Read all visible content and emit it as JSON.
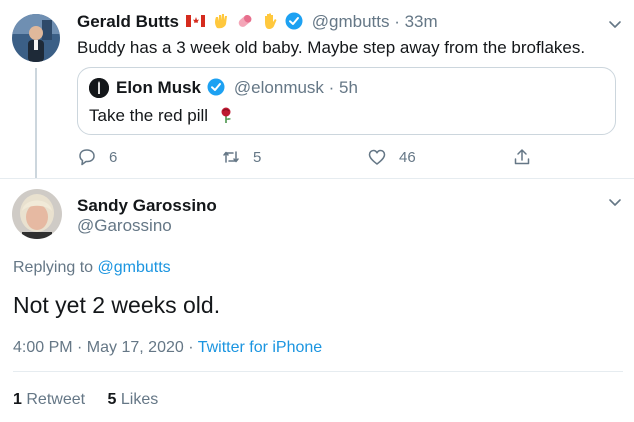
{
  "parent_tweet": {
    "display_name": "Gerald Butts",
    "handle_time": "@gmbutts · 33m",
    "text": "Buddy has a 3 week old baby. Maybe step away from the broflakes.",
    "name_emojis": [
      "canada-flag-icon",
      "waving-hand-icon",
      "pill-icon",
      "raised-hand-icon"
    ],
    "verified": true,
    "quoted": {
      "display_name": "Elon Musk",
      "handle_time": "@elonmusk · 5h",
      "text": "Take the red pill",
      "emoji": "rose-icon",
      "verified": true
    },
    "actions": {
      "replies": "6",
      "retweets": "5",
      "likes": "46"
    }
  },
  "reply_tweet": {
    "display_name": "Sandy Garossino",
    "handle": "@Garossino",
    "replying_prefix": "Replying to",
    "replying_handle": "@gmbutts",
    "text": "Not yet 2 weeks old.",
    "timestamp": "4:00 PM · May 17, 2020 ·",
    "source": "Twitter for iPhone",
    "retweet_count": "1",
    "retweet_label": "Retweet",
    "like_count": "5",
    "like_label": "Likes"
  },
  "colors": {
    "accent": "#1b95e0",
    "verified": "#1da1f2",
    "secondary_text": "#657786",
    "border": "#ccd6dd"
  }
}
